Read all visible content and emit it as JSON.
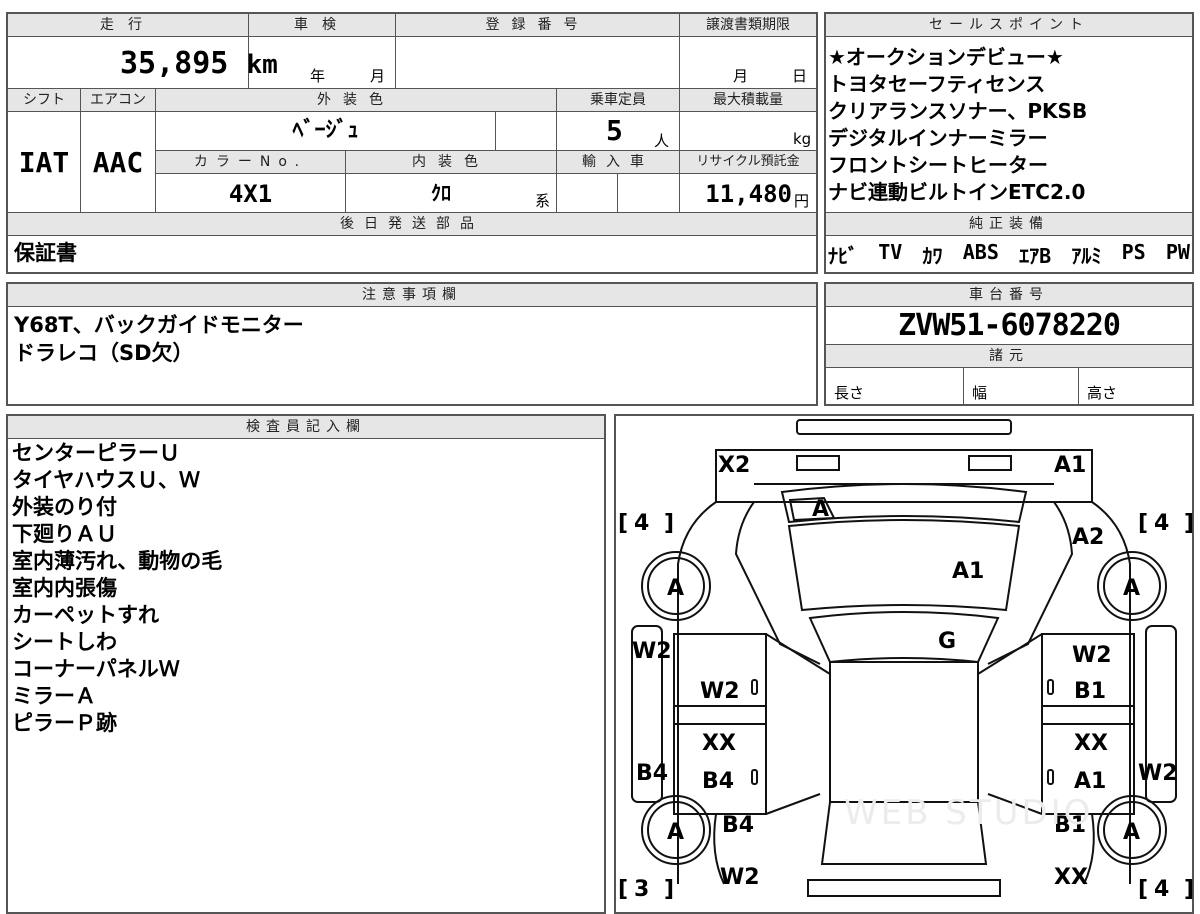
{
  "record": {
    "mileage": {
      "label": "走行",
      "value": "35,895",
      "unit": "km"
    },
    "inspection": {
      "label": "車検",
      "year": "年",
      "month": "月"
    },
    "registration": {
      "label": "登録番号"
    },
    "transfer": {
      "label": "譲渡書類期限",
      "month": "月",
      "day": "日"
    },
    "shift": {
      "label": "シフト",
      "value": "IAT"
    },
    "aircon": {
      "label": "エアコン",
      "value": "AAC"
    },
    "exterior_color": {
      "label": "外装色",
      "value": "ﾍﾞｰｼﾞｭ"
    },
    "capacity": {
      "label": "乗車定員",
      "value": "5",
      "unit": "人"
    },
    "max_load": {
      "label": "最大積載量",
      "unit": "kg"
    },
    "color_no": {
      "label": "カラーNo.",
      "value": "4X1"
    },
    "interior_color": {
      "label": "内装色",
      "value": "ｸﾛ",
      "suffix": "系"
    },
    "import": {
      "label": "輸入車"
    },
    "recycle": {
      "label": "リサイクル預託金",
      "value": "11,480",
      "unit": "円"
    },
    "later_parts": {
      "label": "後日発送部品",
      "value": "保証書"
    }
  },
  "sales": {
    "label": "セールスポイント",
    "points": [
      "★オークションデビュー★",
      "トヨタセーフティセンス",
      "クリアランスソナー、PKSB",
      "デジタルインナーミラー",
      "フロントシートヒーター",
      "ナビ連動ビルトインETC2.0"
    ]
  },
  "equipment": {
    "label": "純正装備",
    "items": [
      "ﾅﾋﾞ",
      "TV",
      "ｶﾜ",
      "ABS",
      "ｴｱB",
      "ｱﾙﾐ",
      "PS",
      "PW"
    ]
  },
  "notes": {
    "label": "注意事項欄",
    "lines": [
      "Y68T、バックガイドモニター",
      "ドラレコ（SD欠）"
    ]
  },
  "chassis": {
    "label": "車台番号",
    "value": "ZVW51-6078220",
    "spec_label": "諸元",
    "length": "長さ",
    "width": "幅",
    "height": "高さ"
  },
  "inspector": {
    "label": "検査員記入欄",
    "lines": [
      "センターピラーＵ",
      "タイヤハウスＵ、Ｗ",
      "外装のり付",
      "下廻りＡＵ",
      "室内薄汚れ、動物の毛",
      "室内内張傷",
      "カーペットすれ",
      "シートしわ",
      "コーナーパネルＷ",
      "ミラーＡ",
      "ピラーＰ跡"
    ]
  },
  "diagram": {
    "tires": {
      "fl": "4",
      "fr": "4",
      "rl": "3",
      "rr": "4"
    },
    "marks": {
      "x2": "X2",
      "a1_top": "A1",
      "a_windshield": "A",
      "a2_right": "A2",
      "a1_hood": "A1",
      "g_roof": "G",
      "wheel_fl": "A",
      "wheel_fr": "A",
      "wheel_rl": "A",
      "wheel_rr": "A",
      "w2_left_fender": "W2",
      "w2_right_fender": "W2",
      "w2_left_front_door": "W2",
      "b1_right_front_door": "B1",
      "xx_left_rear_door": "XX",
      "b4_left_rear_door": "B4",
      "xx_right_rear_door": "XX",
      "a1_right_rear_door": "A1",
      "b4_left_side": "B4",
      "w2_right_side": "W2",
      "b4_left_quarter": "B4",
      "b1_right_quarter": "B1",
      "w2_left_rear": "W2",
      "xx_right_rear": "XX",
      "zero": "0"
    },
    "watermark": "WEB STUDIO"
  }
}
